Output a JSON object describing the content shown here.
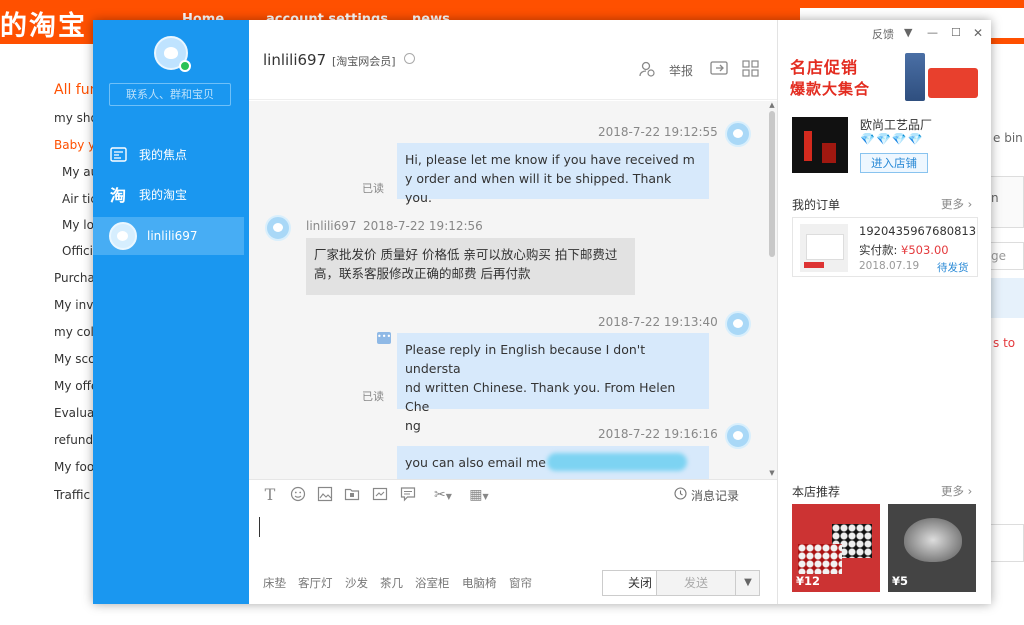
{
  "background": {
    "logo": "的淘宝",
    "nav": [
      "Home",
      "account settings",
      "news"
    ],
    "sidebar": [
      "All fun",
      "my shop",
      "Baby yo",
      "My au",
      "Air tic",
      "My lot",
      "Officia",
      "Purchas",
      "My invo",
      "my coll",
      "My scor",
      "My offe",
      "Evaluat",
      "refund",
      "My foot",
      "Traffic"
    ],
    "right_texts": [
      "e bin",
      "n",
      "ge",
      "s to"
    ]
  },
  "window": {
    "controls": {
      "feedback": "反馈",
      "dropdown": "▼",
      "minimize": "—",
      "maximize": "☐",
      "close": "✕"
    }
  },
  "left_panel": {
    "search_placeholder": "联系人、群和宝贝",
    "nav": [
      {
        "label": "我的焦点",
        "icon": "focus-icon"
      },
      {
        "label": "我的淘宝",
        "icon": "taobao-icon"
      },
      {
        "label": "linlili697",
        "icon": "avatar"
      }
    ]
  },
  "chat": {
    "contact_name": "linlili697",
    "contact_badge": "[淘宝网会员]",
    "report_label": "举报",
    "messages": [
      {
        "dir": "out",
        "time": "2018-7-22 19:12:55",
        "text": "Hi, please let me know if you have received my order and when will it be shipped. Thank you.",
        "lines": [
          "Hi, please let me know if you have received m",
          "y order and when will it be shipped. Thank you."
        ],
        "status": "已读"
      },
      {
        "dir": "in",
        "sender": "linlili697",
        "time": "2018-7-22 19:12:56",
        "lines": [
          "厂家批发价 质量好 价格低 亲可以放心购买 拍下邮费过",
          "高，联系客服修改正确的邮费 后再付款"
        ]
      },
      {
        "dir": "out",
        "time": "2018-7-22 19:13:40",
        "lines": [
          "Please reply in English because I don't understa",
          "nd written Chinese. Thank you. From Helen Che",
          "ng"
        ],
        "status": "已读"
      },
      {
        "dir": "out",
        "time": "2018-7-22 19:16:16",
        "lines": [
          "you can also email me"
        ]
      }
    ],
    "history_label": "消息记录",
    "quick_words": [
      "床垫",
      "客厅灯",
      "沙发",
      "茶几",
      "浴室柜",
      "电脑椅",
      "窗帘"
    ],
    "close_label": "关闭",
    "send_label": "发送"
  },
  "right_panel": {
    "promo_title": "名店促销",
    "promo_sub": "爆款大集合",
    "shop_name": "欧尚工艺品厂",
    "diamonds": "💎💎💎💎",
    "enter_shop": "进入店铺",
    "orders_title": "我的订单",
    "more": "更多",
    "order": {
      "number": "1920435967680813",
      "paid_label": "实付款:",
      "paid_amount": "¥503.00",
      "date": "2018.07.19",
      "status": "待发货"
    },
    "recommend_title": "本店推荐",
    "recommend": [
      {
        "price": "¥12"
      },
      {
        "price": "¥5"
      }
    ]
  },
  "colors": {
    "brand_orange": "#ff5000",
    "sidebar_blue": "#1a97f0",
    "bubble_blue": "#d7e9fb",
    "promo_red": "#e32c20"
  }
}
